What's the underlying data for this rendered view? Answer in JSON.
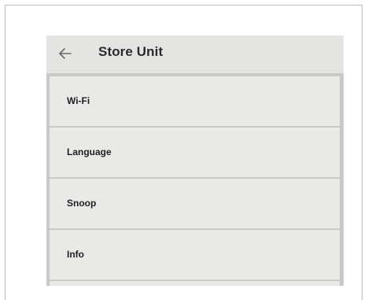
{
  "appbar": {
    "back_icon": "arrow-left-icon",
    "title": "Store Unit"
  },
  "menu": {
    "items": [
      {
        "label": "Wi-Fi"
      },
      {
        "label": "Language"
      },
      {
        "label": "Snoop"
      },
      {
        "label": "Info"
      }
    ]
  },
  "colors": {
    "background": "#e9e9e7",
    "divider": "#c9c9c7",
    "text": "#1f1f1f"
  }
}
